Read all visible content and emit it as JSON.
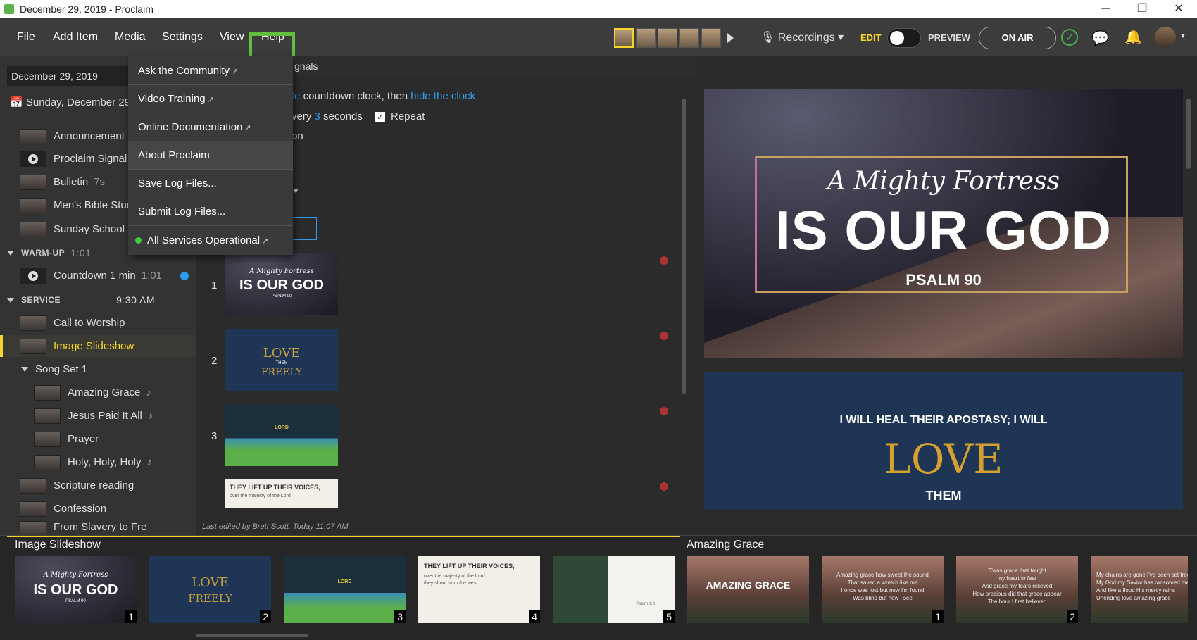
{
  "window": {
    "title": "December 29, 2019 - Proclaim",
    "min": "─",
    "restore": "❐",
    "close": "✕"
  },
  "menu": {
    "file": "File",
    "add_item": "Add Item",
    "media": "Media",
    "settings": "Settings",
    "view": "View",
    "help": "Help"
  },
  "toolbar": {
    "recordings": "Recordings ▾",
    "edit": "EDIT",
    "preview": "PREVIEW",
    "on_air": "ON AIR"
  },
  "left": {
    "date_field": "December 29, 2019",
    "date_display": "Sunday, December 29",
    "pre_items": [
      {
        "label": "Announcement",
        "meta": ""
      },
      {
        "label": "Proclaim Signal",
        "meta": ""
      },
      {
        "label": "Bulletin",
        "meta": "7s"
      },
      {
        "label": "Men's Bible Stud",
        "meta": ""
      },
      {
        "label": "Sunday School",
        "meta": ""
      }
    ],
    "warmup": {
      "label": "WARM-UP",
      "time": "1:01"
    },
    "countdown": {
      "label": "Countdown 1 min",
      "time": "1:01"
    },
    "service": {
      "label": "SERVICE",
      "time": "9:30 AM"
    },
    "service_items": [
      "Call to Worship",
      "Image Slideshow"
    ],
    "song_set": "Song Set 1",
    "songs": [
      {
        "label": "Amazing Grace",
        "note": "♪"
      },
      {
        "label": "Jesus Paid It All",
        "note": "♪"
      },
      {
        "label": "Prayer",
        "note": ""
      },
      {
        "label": "Holy, Holy, Holy",
        "note": "♪"
      }
    ],
    "after": [
      "Scripture reading",
      "Confession",
      "From Slavery to Fre"
    ]
  },
  "center": {
    "tab_partial": "gnals",
    "line1_a": "te",
    "line1_b": " countdown clock, then ",
    "line1_link": "hide the clock",
    "line2_a": "very ",
    "line2_num": "3",
    "line2_b": " seconds",
    "repeat": "Repeat",
    "line3": "on",
    "slide_numbers": [
      "1",
      "2",
      "3"
    ],
    "last_edited": "Last edited by Brett Scott, Today 11:07 AM"
  },
  "dropdown": {
    "items": [
      "Ask the Community",
      "Video Training",
      "Online Documentation",
      "About Proclaim",
      "Save Log Files...",
      "Submit Log Files...",
      "All Services Operational"
    ]
  },
  "slide_text": {
    "s1_script": "A Mighty Fortress",
    "s1_main": "IS OUR GOD",
    "s1_ref": "PSALM 90",
    "s2_arc": "I WILL HEAL THEIR APOSTASY; I WILL",
    "s2_love": "LOVE",
    "s2_them": "THEM",
    "s2_freely": "FREELY",
    "s3_lord": "LORD",
    "s4_title": "THEY LIFT UP THEIR VOICES,",
    "s4_line": "over the majesty of the Lord",
    "s4_from": "they shout from the west.",
    "s5_ref": "Psalm 1:3",
    "ag_title": "AMAZING GRACE",
    "ag1": [
      "Amazing grace how sweet the sound",
      "That saved a wretch like me",
      "I once was lost but now I'm found",
      "Was blind but now I see"
    ],
    "ag2": [
      "'Twas grace that taught",
      "my heart to fear",
      "And grace my fears relieved",
      "How precious did that grace appear",
      "The hour I first believed"
    ],
    "ag3": [
      "My chains are gone I've been set free",
      "My God my Savior has ransomed me",
      "And like a flood His mercy rains",
      "Unending love amazing grace"
    ]
  },
  "bottom": {
    "left_title": "Image Slideshow",
    "right_title": "Amazing Grace",
    "nums": [
      "1",
      "2",
      "3",
      "4",
      "5",
      "1",
      "2"
    ]
  },
  "colors": {
    "accent": "#f5d52b",
    "link": "#2c9cf0",
    "help_highlight": "#5fbf3f"
  }
}
